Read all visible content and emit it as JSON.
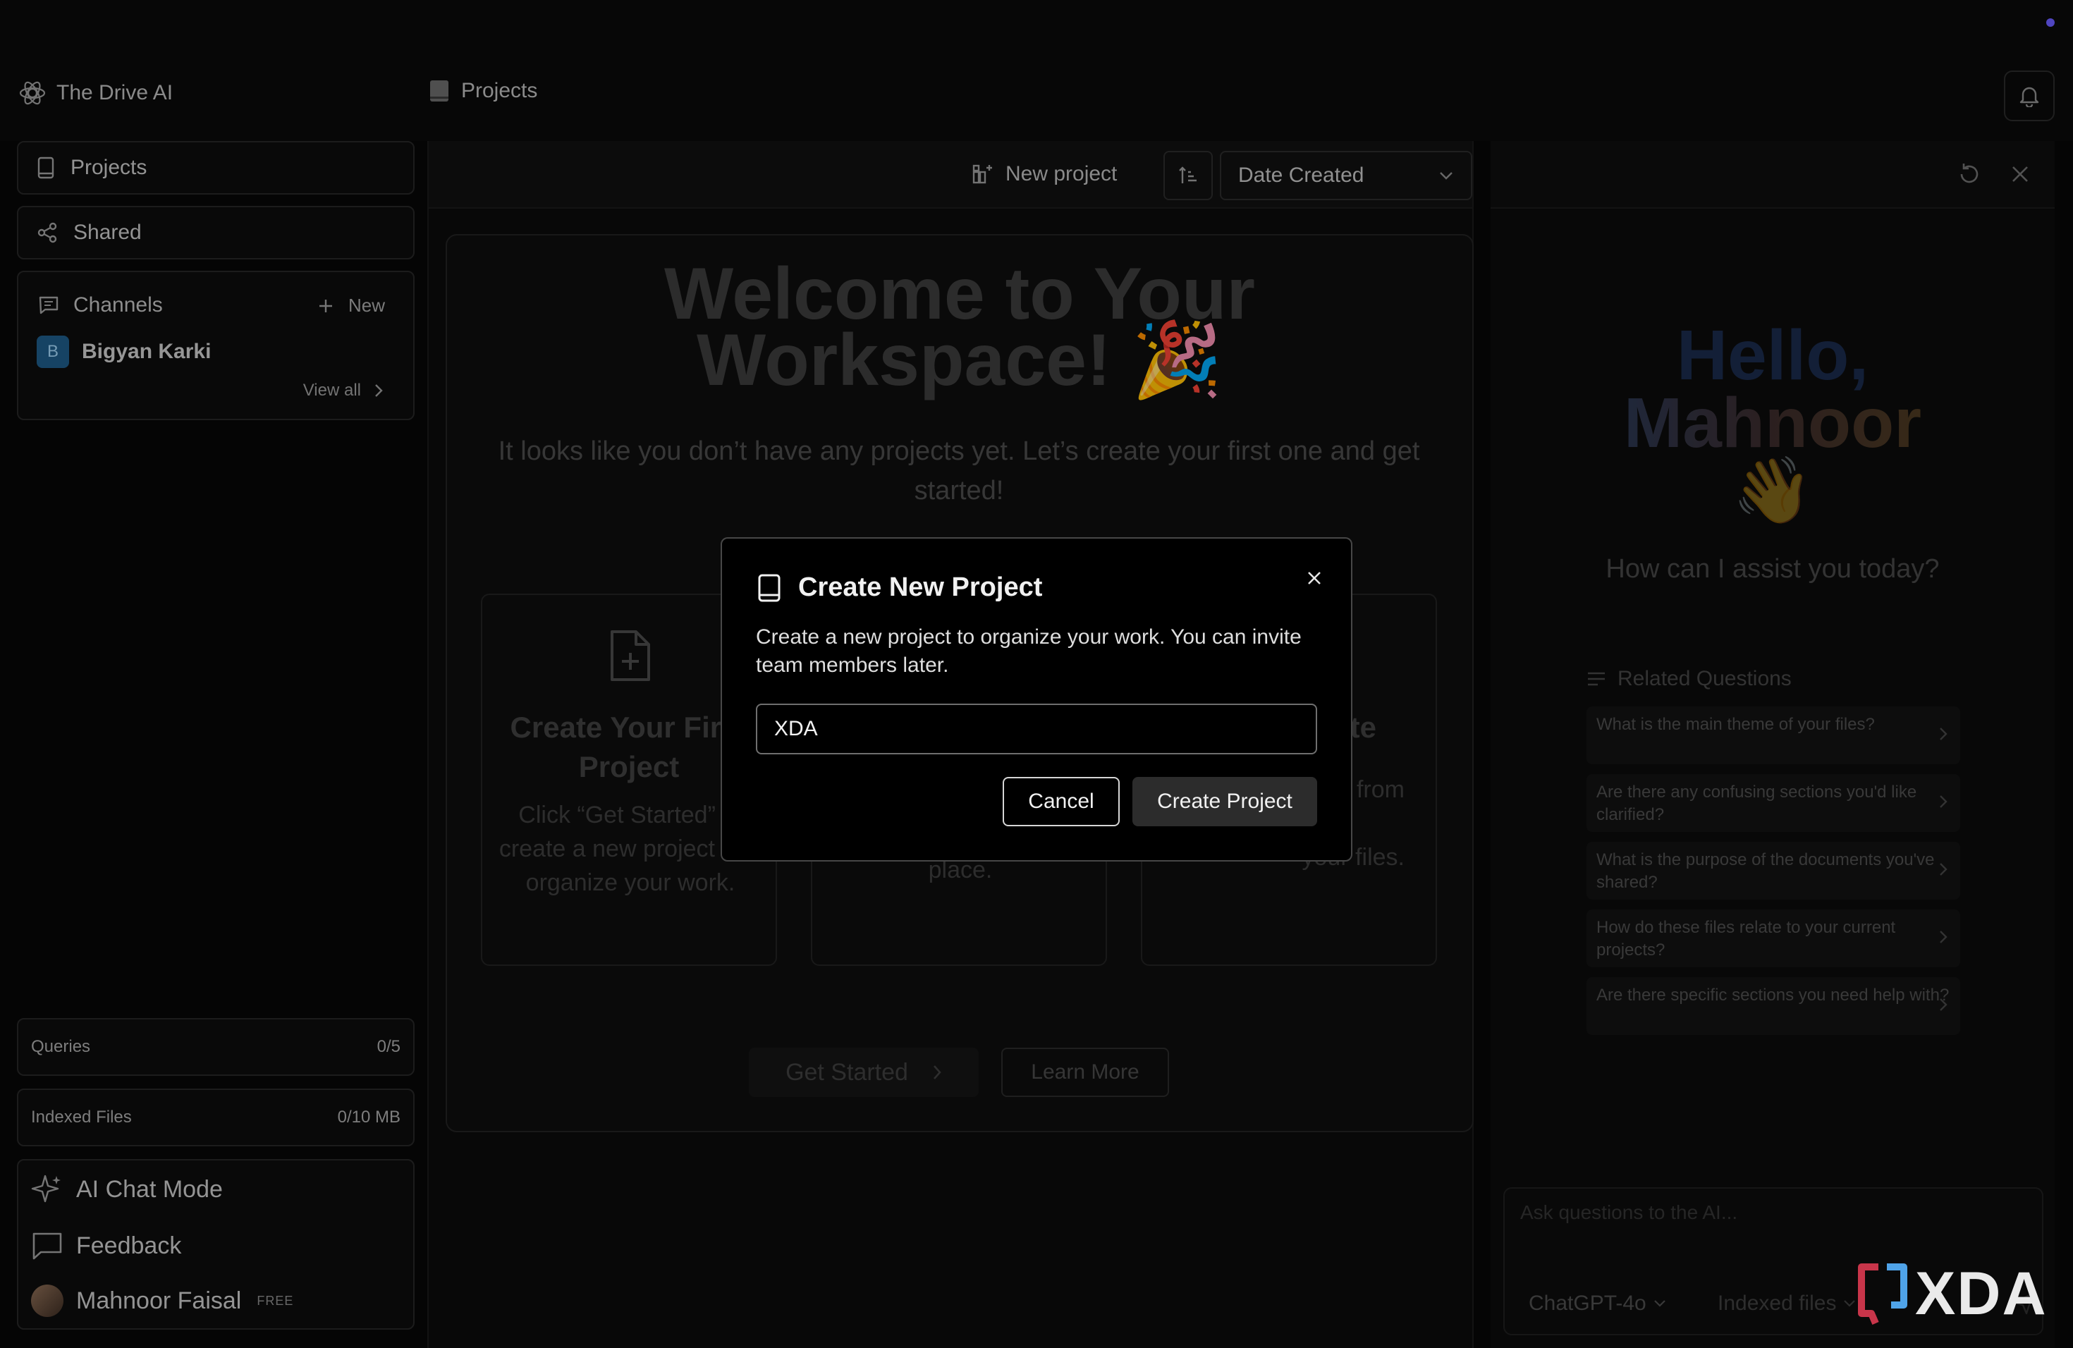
{
  "app": {
    "name": "The Drive AI"
  },
  "header": {
    "breadcrumb": "Projects"
  },
  "sidebar": {
    "projects_label": "Projects",
    "shared_label": "Shared",
    "channels": {
      "title": "Channels",
      "new_label": "New",
      "user_initial": "B",
      "user_name": "Bigyan Karki",
      "view_all": "View all"
    },
    "queries": {
      "label": "Queries",
      "value": "0/5"
    },
    "indexed_files": {
      "label": "Indexed Files",
      "value": "0/10 MB"
    },
    "ai_chat_mode": "AI Chat Mode",
    "feedback": "Feedback",
    "user": {
      "name": "Mahnoor Faisal",
      "plan": "FREE"
    }
  },
  "toolbar": {
    "new_project": "New project",
    "sort_value": "Date Created"
  },
  "welcome": {
    "title_line1": "Welcome to Your",
    "title_line2": "Workspace! 🎉",
    "subtitle": "It looks like you don’t have any projects yet. Let’s create your first one and get started!",
    "card1_title": "Create Your First Project",
    "card1_desc": "Click “Get Started” to create a new project and organize your work.",
    "card2_desc": "place.",
    "card3_title": "te",
    "card3_desc": "ions from your files.",
    "get_started": "Get Started",
    "learn_more": "Learn More"
  },
  "assistant": {
    "hello_line1": "Hello,",
    "hello_line2": "Mahnoor",
    "wave": "👋",
    "prompt": "How can I assist you today?",
    "related_title": "Related Questions",
    "questions": [
      "What is the main theme of your files?",
      "Are there any confusing sections you'd like clarified?",
      "What is the purpose of the documents you've shared?",
      "How do these files relate to your current projects?",
      "Are there specific sections you need help with?"
    ],
    "chat_placeholder": "Ask questions to the AI...",
    "model": "ChatGPT-4o",
    "files_selector": "Indexed files"
  },
  "watermark": {
    "text": "XDA"
  },
  "modal": {
    "title": "Create New Project",
    "description": "Create a new project to organize your work. You can invite team members later.",
    "input_value": "XDA",
    "cancel": "Cancel",
    "create": "Create Project"
  },
  "colors": {
    "background": "#070707",
    "modal_border": "#474747",
    "notification_dot": "#6a5cff"
  }
}
